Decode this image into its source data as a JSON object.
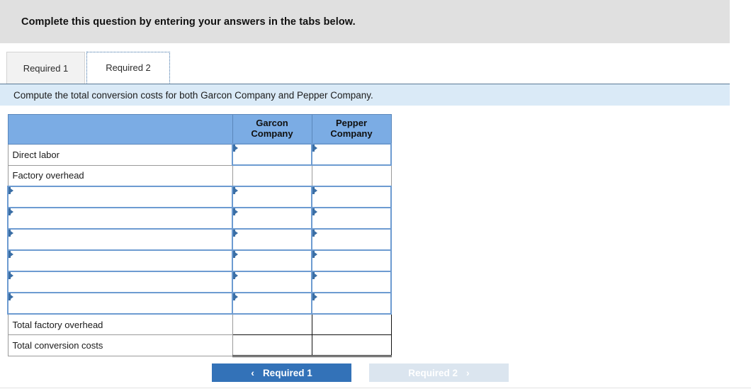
{
  "banner": {
    "text": "Complete this question by entering your answers in the tabs below."
  },
  "tabs": [
    {
      "label": "Required 1",
      "active": false
    },
    {
      "label": "Required 2",
      "active": true
    }
  ],
  "requirement": {
    "text": "Compute the total conversion costs for both Garcon Company and Pepper Company."
  },
  "table": {
    "columns": [
      {
        "label": ""
      },
      {
        "label": "Garcon\nCompany",
        "line1": "Garcon",
        "line2": "Company"
      },
      {
        "label": "Pepper\nCompany",
        "line1": "Pepper",
        "line2": "Company"
      }
    ],
    "rows": [
      {
        "label": "Direct labor",
        "label_editable": false,
        "values": [
          "",
          ""
        ],
        "value_kind": "input"
      },
      {
        "label": "Factory overhead",
        "label_editable": false,
        "values": [
          "",
          ""
        ],
        "value_kind": "plain"
      },
      {
        "label": "",
        "label_editable": true,
        "values": [
          "",
          ""
        ],
        "value_kind": "input"
      },
      {
        "label": "",
        "label_editable": true,
        "values": [
          "",
          ""
        ],
        "value_kind": "input"
      },
      {
        "label": "",
        "label_editable": true,
        "values": [
          "",
          ""
        ],
        "value_kind": "input"
      },
      {
        "label": "",
        "label_editable": true,
        "values": [
          "",
          ""
        ],
        "value_kind": "input"
      },
      {
        "label": "",
        "label_editable": true,
        "values": [
          "",
          ""
        ],
        "value_kind": "input"
      },
      {
        "label": "",
        "label_editable": true,
        "values": [
          "",
          ""
        ],
        "value_kind": "input"
      },
      {
        "label": "Total factory overhead",
        "label_editable": false,
        "values": [
          "",
          ""
        ],
        "value_kind": "total"
      },
      {
        "label": "Total conversion costs",
        "label_editable": false,
        "values": [
          "",
          ""
        ],
        "value_kind": "grandtotal"
      }
    ]
  },
  "nav": {
    "prev_label": "Required 1",
    "prev_icon": "chevron-left-icon",
    "prev_chevron": "‹",
    "next_label": "Required 2",
    "next_icon": "chevron-right-icon",
    "next_chevron": "›"
  },
  "colors": {
    "banner_bg": "#e0e0e0",
    "requirement_bg": "#daeaf7",
    "table_header_bg": "#7bace4",
    "input_border": "#6d9bd1",
    "marker": "#3a6ea5",
    "prev_button_bg": "#3372b8",
    "next_button_bg": "#dbe5ef"
  }
}
